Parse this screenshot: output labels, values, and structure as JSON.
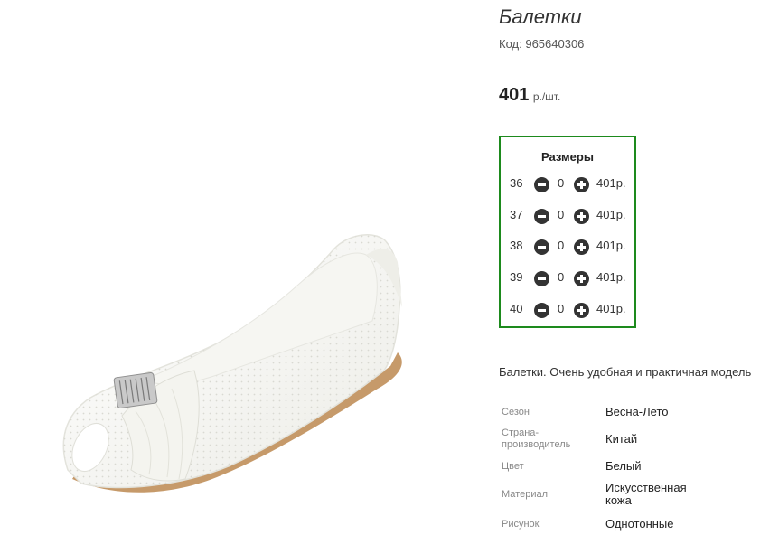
{
  "product": {
    "title": "Балетки",
    "code_label": "Код:",
    "code": "965640306",
    "price": "401",
    "price_unit": "р./шт.",
    "description": "Балетки. Очень удобная и практичная модель"
  },
  "sizes": {
    "title": "Размеры",
    "rows": [
      {
        "size": "36",
        "qty": "0",
        "price": "401р."
      },
      {
        "size": "37",
        "qty": "0",
        "price": "401р."
      },
      {
        "size": "38",
        "qty": "0",
        "price": "401р."
      },
      {
        "size": "39",
        "qty": "0",
        "price": "401р."
      },
      {
        "size": "40",
        "qty": "0",
        "price": "401р."
      }
    ]
  },
  "attributes": [
    {
      "label": "Сезон",
      "value": "Весна-Лето"
    },
    {
      "label": "Страна-производитель",
      "value": "Китай"
    },
    {
      "label": "Цвет",
      "value": "Белый"
    },
    {
      "label": "Материал",
      "value": "Искусственная кожа"
    },
    {
      "label": "Рисунок",
      "value": "Однотонные"
    }
  ],
  "colors": {
    "sizes_border": "#1d8a1d",
    "button": "#333333"
  },
  "icons": {
    "minus": "minus-circle-icon",
    "plus": "plus-circle-icon"
  }
}
